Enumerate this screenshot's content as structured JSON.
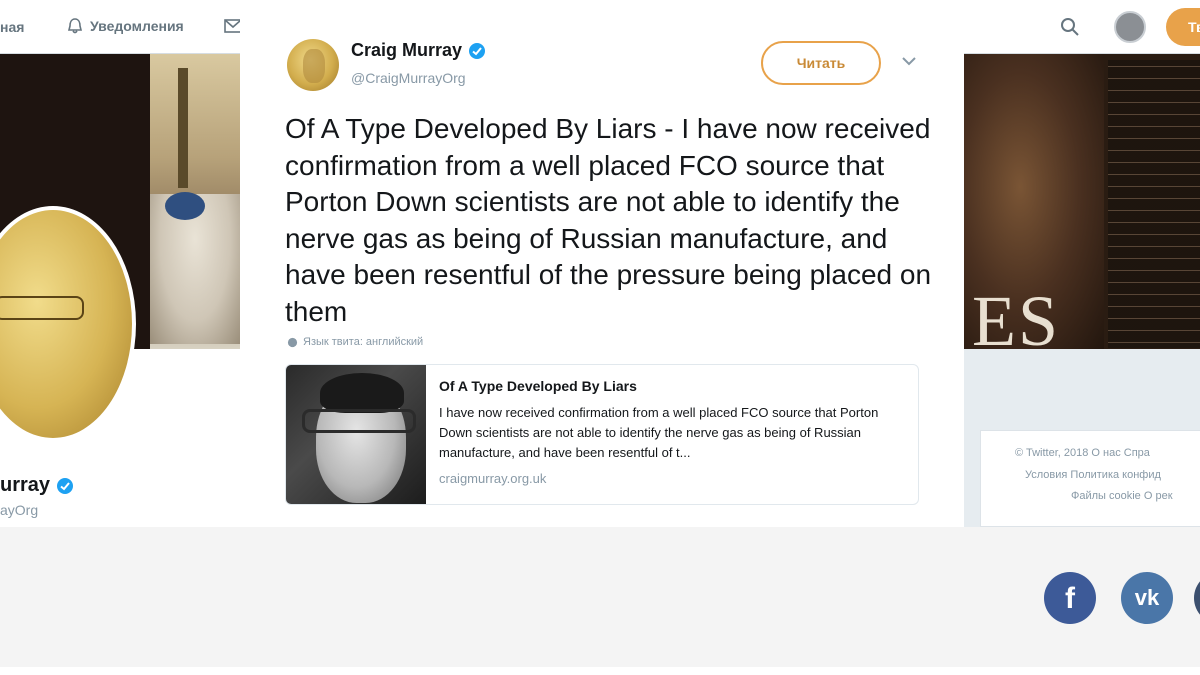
{
  "topbar": {
    "home_label": "Главная",
    "home_label_visible": "ная",
    "notifications_label": "Уведомления",
    "tweet_button_label": "Тв",
    "icons": [
      "bell-icon",
      "envelope-icon",
      "search-icon",
      "avatar",
      "tweet-button"
    ]
  },
  "banner": {
    "right_text": "ES"
  },
  "profile": {
    "name": "urray",
    "handle": "ayOrg",
    "verified": true
  },
  "tweet": {
    "author_name": "Craig Murray",
    "author_handle": "@CraigMurrayOrg",
    "verified": true,
    "follow_label": "Читать",
    "text": "Of A Type Developed By Liars - I have now received confirmation from a well placed FCO source that Porton Down scientists are not able to identify the nerve gas as being of Russian manufacture, and have been resentful of the pressure being placed on them",
    "language_note": "Язык твита: английский",
    "card": {
      "title": "Of A Type Developed By Liars",
      "description": "I have now received confirmation from a well placed FCO source that Porton Down scientists are not able to identify the nerve gas as being of Russian manufacture, and have been resentful of t...",
      "domain": "craigmurray.org.uk"
    }
  },
  "sidebar_footer": {
    "row1": "© Twitter, 2018   О нас   Спра",
    "row2": "Условия   Политика конфид",
    "row3": "Файлы cookie   О рек"
  },
  "share": {
    "facebook_glyph": "f",
    "vk_glyph": "vk"
  },
  "colors": {
    "accent": "#e8a24a",
    "verified": "#1da1f2",
    "facebook": "#3d5a98",
    "vk": "#4a76a8",
    "text": "#14171a",
    "muted": "#8899a6"
  }
}
